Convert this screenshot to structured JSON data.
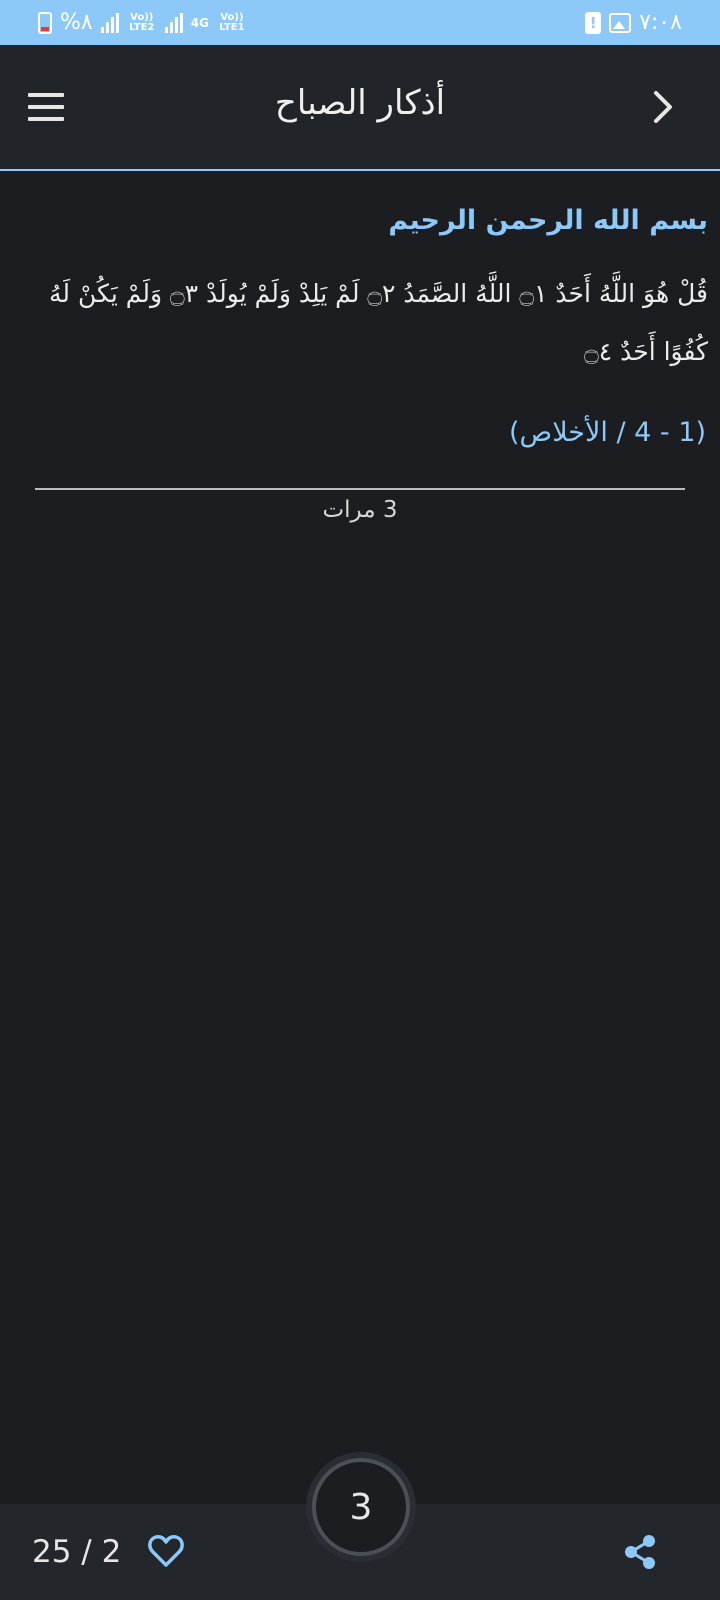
{
  "status_bar": {
    "battery_text": "%٨",
    "sim2_label": "Vo)) LTE2",
    "network_type": "4G",
    "sim1_label": "Vo)) LTE1",
    "time": "٧:٠٨"
  },
  "app_bar": {
    "title": "أذكار الصباح"
  },
  "content": {
    "basmala": "بسم الله الرحمن الرحيم",
    "verse": "قُلْ هُوَ اللَّهُ أَحَدٌ ۝١ اللَّهُ الصَّمَدُ ۝٢ لَمْ يَلِدْ وَلَمْ يُولَدْ ۝٣ وَلَمْ يَكُنْ لَهُ كُفُوًا أَحَدٌ ۝٤",
    "reference": "(1 - 4 / الأخلاص)",
    "repeat_count_text": "3 مرات"
  },
  "bottom_bar": {
    "page_counter": "25 / 2",
    "counter_value": "3"
  },
  "colors": {
    "accent": "#8cc8f8",
    "background": "#1c1d20",
    "appbar": "#212428"
  }
}
